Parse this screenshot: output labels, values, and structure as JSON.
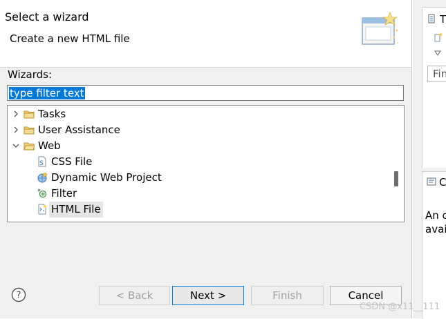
{
  "dialog": {
    "title": "Select a wizard",
    "subtitle": "Create a new HTML file",
    "wizards_label": "Wizards:",
    "filter_value": "type filter text",
    "tree": [
      {
        "label": "Tasks",
        "expanded": false,
        "icon": "folder-icon"
      },
      {
        "label": "User Assistance",
        "expanded": false,
        "icon": "folder-icon"
      },
      {
        "label": "Web",
        "expanded": true,
        "icon": "folder-icon"
      },
      {
        "label": "CSS File",
        "icon": "css-file-icon"
      },
      {
        "label": "Dynamic Web Project",
        "icon": "web-project-icon"
      },
      {
        "label": "Filter",
        "icon": "filter-icon"
      },
      {
        "label": "HTML File",
        "icon": "html-file-icon",
        "selected": true
      }
    ],
    "buttons": {
      "back": "< Back",
      "next": "Next >",
      "finish": "Finish",
      "cancel": "Cancel"
    }
  },
  "side": {
    "top_title": "T",
    "find": "Fin",
    "bottom_title": "C",
    "desc_line1": "An c",
    "desc_line2": "avail"
  },
  "watermark": "CSDN @x11__111",
  "colors": {
    "selection": "#0078d7",
    "default_button_border": "#0078d7"
  }
}
